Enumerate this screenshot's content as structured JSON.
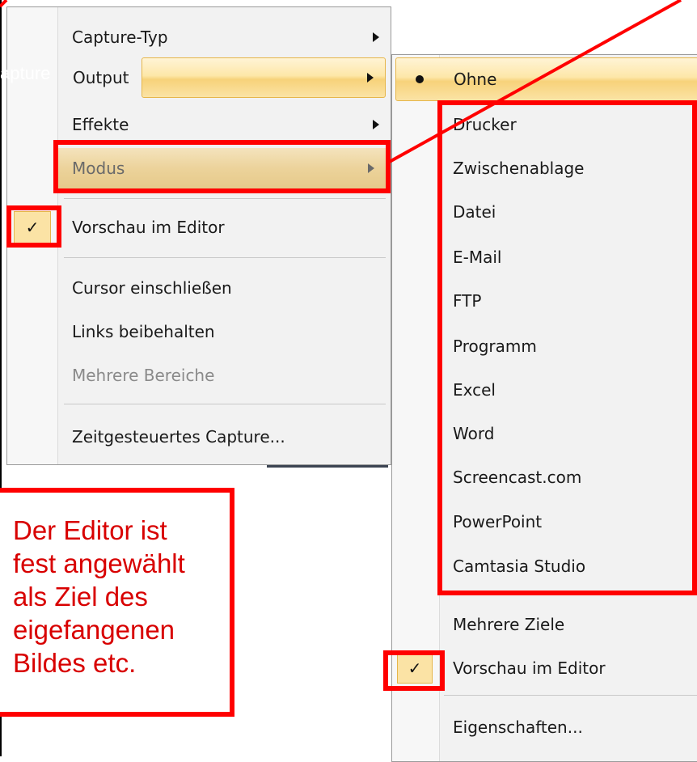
{
  "main_menu": {
    "items": [
      {
        "label": "Capture-Typ"
      },
      {
        "label": "Output"
      },
      {
        "label": "Effekte"
      },
      {
        "label": "Modus"
      },
      {
        "label": "Vorschau im Editor"
      },
      {
        "label": "Cursor einschließen"
      },
      {
        "label": "Links beibehalten"
      },
      {
        "label": "Mehrere Bereiche"
      },
      {
        "label": "Zeitgesteuertes Capture..."
      }
    ],
    "checkmark": "✓"
  },
  "overlay_text": "apture",
  "output_submenu": {
    "items": [
      {
        "label": "Ohne"
      },
      {
        "label": "Drucker"
      },
      {
        "label": "Zwischenablage"
      },
      {
        "label": "Datei"
      },
      {
        "label": "E-Mail"
      },
      {
        "label": "FTP"
      },
      {
        "label": "Programm"
      },
      {
        "label": "Excel"
      },
      {
        "label": "Word"
      },
      {
        "label": "Screencast.com"
      },
      {
        "label": "PowerPoint"
      },
      {
        "label": "Camtasia Studio"
      },
      {
        "label": "Mehrere Ziele"
      },
      {
        "label": "Vorschau im Editor"
      },
      {
        "label": "Eigenschaften..."
      }
    ],
    "checkmark": "✓"
  },
  "callout": {
    "text": "Der Editor ist\nfest angewählt\nals Ziel des\neigefangenen\nBildes etc."
  },
  "colors": {
    "annotation_red": "#ff0000",
    "highlight_gold": "#f7d27a",
    "callout_text": "#d80000"
  }
}
